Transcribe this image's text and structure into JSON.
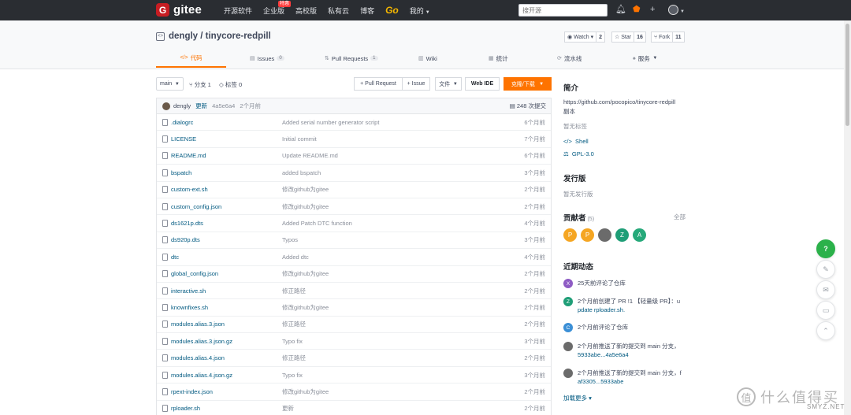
{
  "nav": {
    "logo_letter": "G",
    "logo_text": "gitee",
    "items": [
      {
        "label": "开源软件",
        "badge": ""
      },
      {
        "label": "企业版",
        "badge": "特惠"
      },
      {
        "label": "高校版",
        "badge": ""
      },
      {
        "label": "私有云",
        "badge": ""
      },
      {
        "label": "博客",
        "badge": ""
      },
      {
        "label": "Go",
        "badge": ""
      },
      {
        "label": "我的",
        "badge": ""
      }
    ],
    "search_placeholder": "搜开源"
  },
  "repo": {
    "title": "dengly / tinycore-redpill",
    "watch_label": "Watch",
    "watch_count": "2",
    "star_label": "Star",
    "star_count": "16",
    "fork_label": "Fork",
    "fork_count": "11"
  },
  "tabs": [
    {
      "icon": "</>",
      "label": "代码",
      "count": ""
    },
    {
      "icon": "▤",
      "label": "Issues",
      "count": "0"
    },
    {
      "icon": "⇅",
      "label": "Pull Requests",
      "count": "1"
    },
    {
      "icon": "▥",
      "label": "Wiki",
      "count": ""
    },
    {
      "icon": "▦",
      "label": "统计",
      "count": ""
    },
    {
      "icon": "⟳",
      "label": "流水线",
      "count": ""
    },
    {
      "icon": "♠",
      "label": "服务",
      "count": ""
    }
  ],
  "toolbar": {
    "branch": "main",
    "branches": "分支 1",
    "tags": "标签 0",
    "pull_request": "+ Pull Request",
    "issue": "+ Issue",
    "file": "文件",
    "webide": "Web IDE",
    "clone": "克隆/下载"
  },
  "commit": {
    "user": "dengly",
    "tag": "更新",
    "hash": "4a5e6a4",
    "time": "2个月前",
    "count": "248 次提交"
  },
  "files": [
    {
      "name": ".dialogrc",
      "msg": "Added serial number generator script",
      "time": "6个月前"
    },
    {
      "name": "LICENSE",
      "msg": "Initial commit",
      "time": "7个月前"
    },
    {
      "name": "README.md",
      "msg": "Update README.md",
      "time": "6个月前"
    },
    {
      "name": "bspatch",
      "msg": "added bspatch",
      "time": "3个月前"
    },
    {
      "name": "custom-ext.sh",
      "msg": "修改github为gitee",
      "time": "2个月前"
    },
    {
      "name": "custom_config.json",
      "msg": "修改github为gitee",
      "time": "2个月前"
    },
    {
      "name": "ds1621p.dts",
      "msg": "Added Patch DTC function",
      "time": "4个月前"
    },
    {
      "name": "ds920p.dts",
      "msg": "Typos",
      "time": "3个月前"
    },
    {
      "name": "dtc",
      "msg": "Added dtc",
      "time": "4个月前"
    },
    {
      "name": "global_config.json",
      "msg": "修改github为gitee",
      "time": "2个月前"
    },
    {
      "name": "interactive.sh",
      "msg": "修正路径",
      "time": "2个月前"
    },
    {
      "name": "knownfixes.sh",
      "msg": "修改github为gitee",
      "time": "2个月前"
    },
    {
      "name": "modules.alias.3.json",
      "msg": "修正路径",
      "time": "2个月前"
    },
    {
      "name": "modules.alias.3.json.gz",
      "msg": "Typo fix",
      "time": "3个月前"
    },
    {
      "name": "modules.alias.4.json",
      "msg": "修正路径",
      "time": "2个月前"
    },
    {
      "name": "modules.alias.4.json.gz",
      "msg": "Typo fix",
      "time": "3个月前"
    },
    {
      "name": "rpext-index.json",
      "msg": "修改github为gitee",
      "time": "2个月前"
    },
    {
      "name": "rploader.sh",
      "msg": "更新",
      "time": "2个月前"
    }
  ],
  "sidebar": {
    "intro_title": "简介",
    "intro_text_1": "https://github.com/pocopico/tinycore-redpill",
    "intro_text_2": "副本",
    "no_tags": "暂无标签",
    "lang": "Shell",
    "license": "GPL-3.0",
    "release_title": "发行版",
    "no_release": "暂无发行版",
    "contrib_title": "贡献者",
    "contrib_count": "(5)",
    "contrib_all": "全部",
    "contributors": [
      {
        "letter": "P",
        "color": "#f5a623"
      },
      {
        "letter": "P",
        "color": "#f5a623"
      },
      {
        "letter": "",
        "color": "#6b6b6b"
      },
      {
        "letter": "Z",
        "color": "#1f9e77"
      },
      {
        "letter": "A",
        "color": "#26a97a"
      }
    ],
    "activity_title": "近期动态",
    "activities": [
      {
        "letter": "X",
        "color": "#8e5cc4",
        "line1": "25天前评论了仓库",
        "line2": ""
      },
      {
        "letter": "Z",
        "color": "#1f9e77",
        "line1": "2个月前创建了 PR !1 【轻量级 PR】：u",
        "line2": "pdate rploader.sh."
      },
      {
        "letter": "C",
        "color": "#3b8fd6",
        "line1": "2个月前评论了仓库",
        "line2": ""
      },
      {
        "letter": "",
        "color": "#6b6b6b",
        "line1": "2个月前推送了新的提交到 main 分支，",
        "line2": "5933abe...4a5e6a4"
      },
      {
        "letter": "",
        "color": "#6b6b6b",
        "line1": "2个月前推送了新的提交到 main 分支，f",
        "line2": "af3305...5933abe"
      }
    ],
    "load_more": "加载更多"
  },
  "float": {
    "help": "?"
  },
  "watermark": {
    "text": "什么值得买",
    "sub": "SMYZ.NET"
  }
}
